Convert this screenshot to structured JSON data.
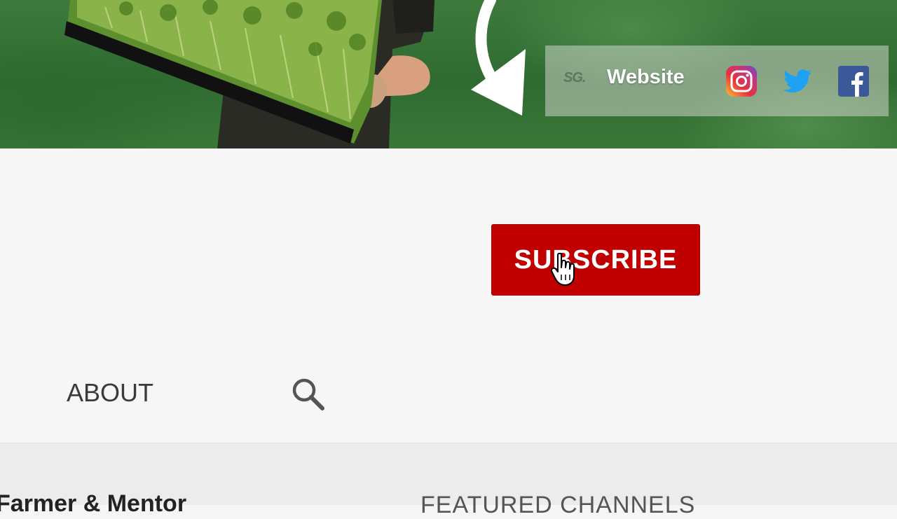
{
  "banner": {
    "site_logo_text": "SG.",
    "website_label": "Website",
    "social_icons": [
      "instagram-icon",
      "twitter-icon",
      "facebook-icon"
    ]
  },
  "channel": {
    "subscribe_label": "SUBSCRIBE"
  },
  "tabs": {
    "about_label": "ABOUT",
    "search_icon": "search-icon"
  },
  "about_section": {
    "bio_heading": "Farmer & Mentor",
    "featured_heading": "FEATURED CHANNELS"
  },
  "colors": {
    "subscribe_red": "#c00000",
    "banner_green": "#3d7a3c",
    "page_background": "#f6f6f6",
    "twitter_blue": "#1da1f2",
    "facebook_blue": "#3b5998"
  }
}
